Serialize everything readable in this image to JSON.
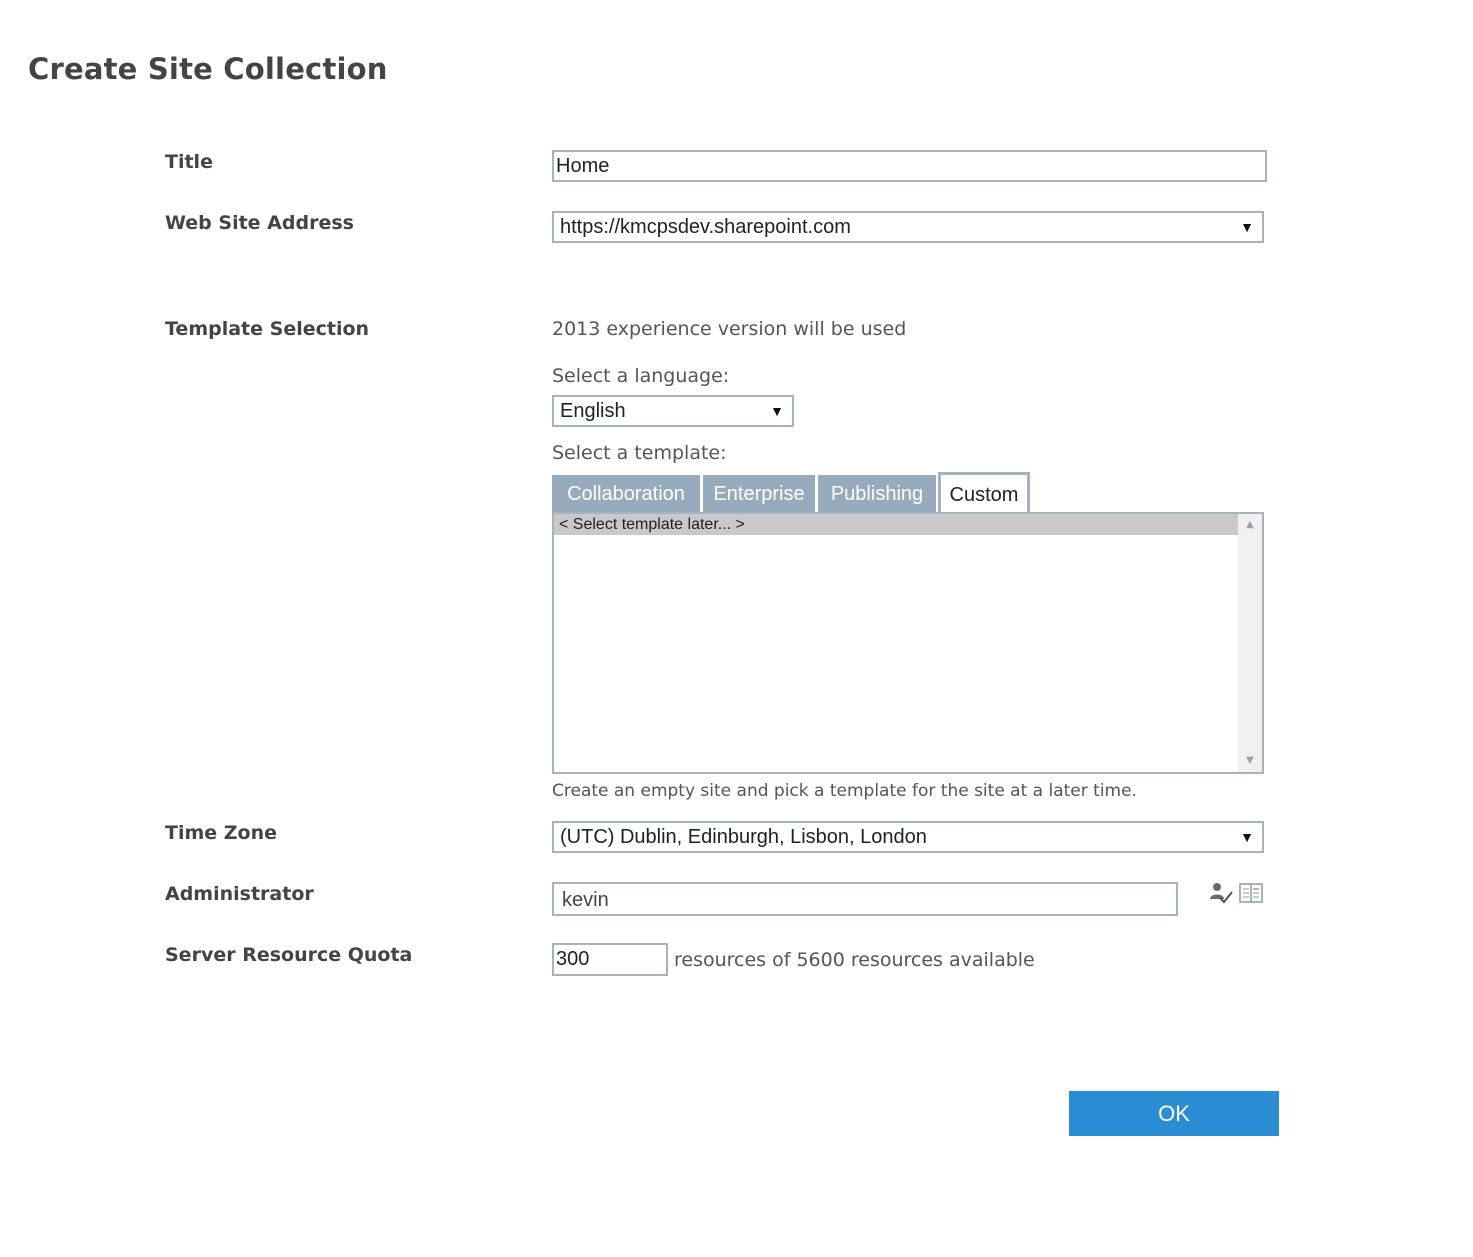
{
  "page": {
    "title": "Create Site Collection"
  },
  "labels": {
    "title": "Title",
    "web_site_address": "Web Site Address",
    "template_selection": "Template Selection",
    "time_zone": "Time Zone",
    "administrator": "Administrator",
    "server_resource_quota": "Server Resource Quota"
  },
  "fields": {
    "title_value": "Home",
    "web_address_value": "https://kmcpsdev.sharepoint.com",
    "time_zone_value": "(UTC) Dublin, Edinburgh, Lisbon, London",
    "administrator_value": "kevin",
    "quota_value": "300",
    "quota_text": "resources of 5600 resources available"
  },
  "template": {
    "experience_text": "2013 experience version will be used",
    "language_prompt": "Select a language:",
    "language_value": "English",
    "template_prompt": "Select a template:",
    "tabs": [
      {
        "label": "Collaboration",
        "active": false
      },
      {
        "label": "Enterprise",
        "active": false
      },
      {
        "label": "Publishing",
        "active": false
      },
      {
        "label": "Custom",
        "active": true
      }
    ],
    "list_items": [
      "< Select template later... >"
    ],
    "description": "Create an empty site and pick a template for the site at a later time."
  },
  "icons": {
    "dropdown_arrow": "dropdown-arrow-icon",
    "check_names": "check-names-icon",
    "browse": "address-book-icon",
    "scroll_up": "scroll-up-icon",
    "scroll_down": "scroll-down-icon"
  },
  "actions": {
    "ok_label": "OK"
  },
  "colors": {
    "tab_inactive": "#98abbd",
    "input_border": "#a6b3bf",
    "ok_button": "#2a8dd4",
    "selected_item": "#c9c9c9"
  }
}
